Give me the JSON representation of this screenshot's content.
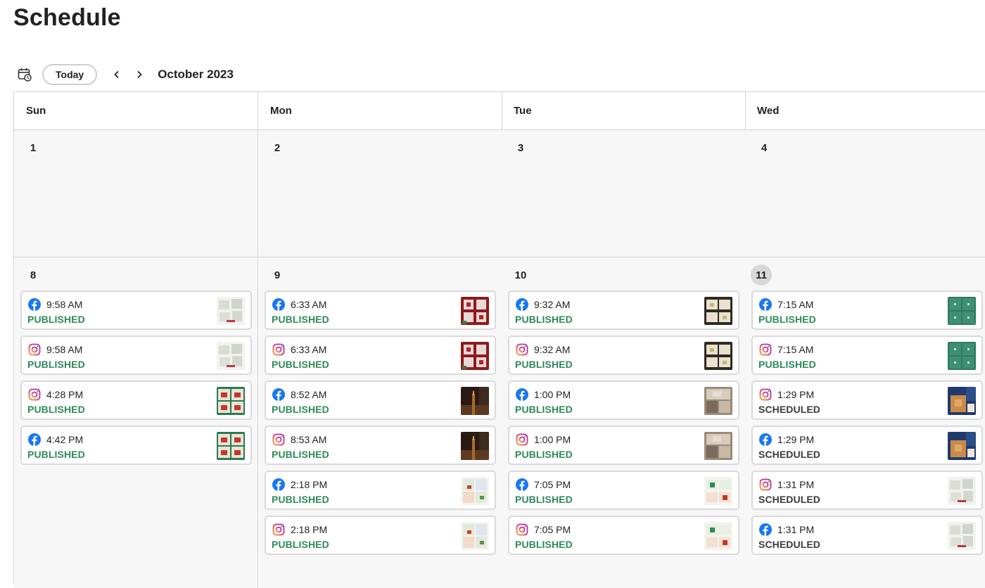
{
  "page": {
    "title": "Schedule"
  },
  "toolbar": {
    "calendar_icon": "calendar-clock-icon",
    "today_label": "Today",
    "prev_icon": "chevron-left-icon",
    "next_icon": "chevron-right-icon",
    "month_label": "October 2023"
  },
  "colors": {
    "published": "#2d8a5a",
    "scheduled": "#3a3a3a",
    "facebook": "#1877f2",
    "instagram": "#d6249f",
    "cell_bg": "#f7f7f7",
    "today_bg": "#d8d8d8"
  },
  "calendar": {
    "weekdays": [
      "Sun",
      "Mon",
      "Tue",
      "Wed"
    ],
    "weeks": [
      {
        "days": [
          {
            "day": "1",
            "today": false,
            "posts": []
          },
          {
            "day": "2",
            "today": false,
            "posts": []
          },
          {
            "day": "3",
            "today": false,
            "posts": []
          },
          {
            "day": "4",
            "today": false,
            "posts": []
          }
        ]
      },
      {
        "days": [
          {
            "day": "8",
            "today": false,
            "posts": [
              {
                "network": "facebook",
                "time": "9:58 AM",
                "status": "PUBLISHED",
                "thumb": "white-pattern"
              },
              {
                "network": "instagram",
                "time": "9:58 AM",
                "status": "PUBLISHED",
                "thumb": "white-pattern"
              },
              {
                "network": "instagram",
                "time": "4:28 PM",
                "status": "PUBLISHED",
                "thumb": "green-red"
              },
              {
                "network": "facebook",
                "time": "4:42 PM",
                "status": "PUBLISHED",
                "thumb": "green-red"
              }
            ]
          },
          {
            "day": "9",
            "today": false,
            "posts": [
              {
                "network": "facebook",
                "time": "6:33 AM",
                "status": "PUBLISHED",
                "thumb": "red-plaid"
              },
              {
                "network": "instagram",
                "time": "6:33 AM",
                "status": "PUBLISHED",
                "thumb": "red-plaid"
              },
              {
                "network": "facebook",
                "time": "8:52 AM",
                "status": "PUBLISHED",
                "thumb": "dark-road"
              },
              {
                "network": "instagram",
                "time": "8:53 AM",
                "status": "PUBLISHED",
                "thumb": "dark-road"
              },
              {
                "network": "facebook",
                "time": "2:18 PM",
                "status": "PUBLISHED",
                "thumb": "light-cards"
              },
              {
                "network": "instagram",
                "time": "2:18 PM",
                "status": "PUBLISHED",
                "thumb": "light-cards"
              }
            ]
          },
          {
            "day": "10",
            "today": false,
            "posts": [
              {
                "network": "facebook",
                "time": "9:32 AM",
                "status": "PUBLISHED",
                "thumb": "dark-cards"
              },
              {
                "network": "instagram",
                "time": "9:32 AM",
                "status": "PUBLISHED",
                "thumb": "dark-cards"
              },
              {
                "network": "facebook",
                "time": "1:00 PM",
                "status": "PUBLISHED",
                "thumb": "tan-room"
              },
              {
                "network": "instagram",
                "time": "1:00 PM",
                "status": "PUBLISHED",
                "thumb": "tan-room"
              },
              {
                "network": "facebook",
                "time": "7:05 PM",
                "status": "PUBLISHED",
                "thumb": "elf-cards"
              },
              {
                "network": "instagram",
                "time": "7:05 PM",
                "status": "PUBLISHED",
                "thumb": "elf-cards"
              }
            ]
          },
          {
            "day": "11",
            "today": true,
            "posts": [
              {
                "network": "facebook",
                "time": "7:15 AM",
                "status": "PUBLISHED",
                "thumb": "teal-pattern"
              },
              {
                "network": "instagram",
                "time": "7:15 AM",
                "status": "PUBLISHED",
                "thumb": "teal-pattern"
              },
              {
                "network": "instagram",
                "time": "1:29 PM",
                "status": "SCHEDULED",
                "thumb": "blue-orange"
              },
              {
                "network": "facebook",
                "time": "1:29 PM",
                "status": "SCHEDULED",
                "thumb": "blue-orange"
              },
              {
                "network": "instagram",
                "time": "1:31 PM",
                "status": "SCHEDULED",
                "thumb": "white-pattern"
              },
              {
                "network": "facebook",
                "time": "1:31 PM",
                "status": "SCHEDULED",
                "thumb": "white-pattern"
              }
            ]
          }
        ]
      }
    ]
  }
}
